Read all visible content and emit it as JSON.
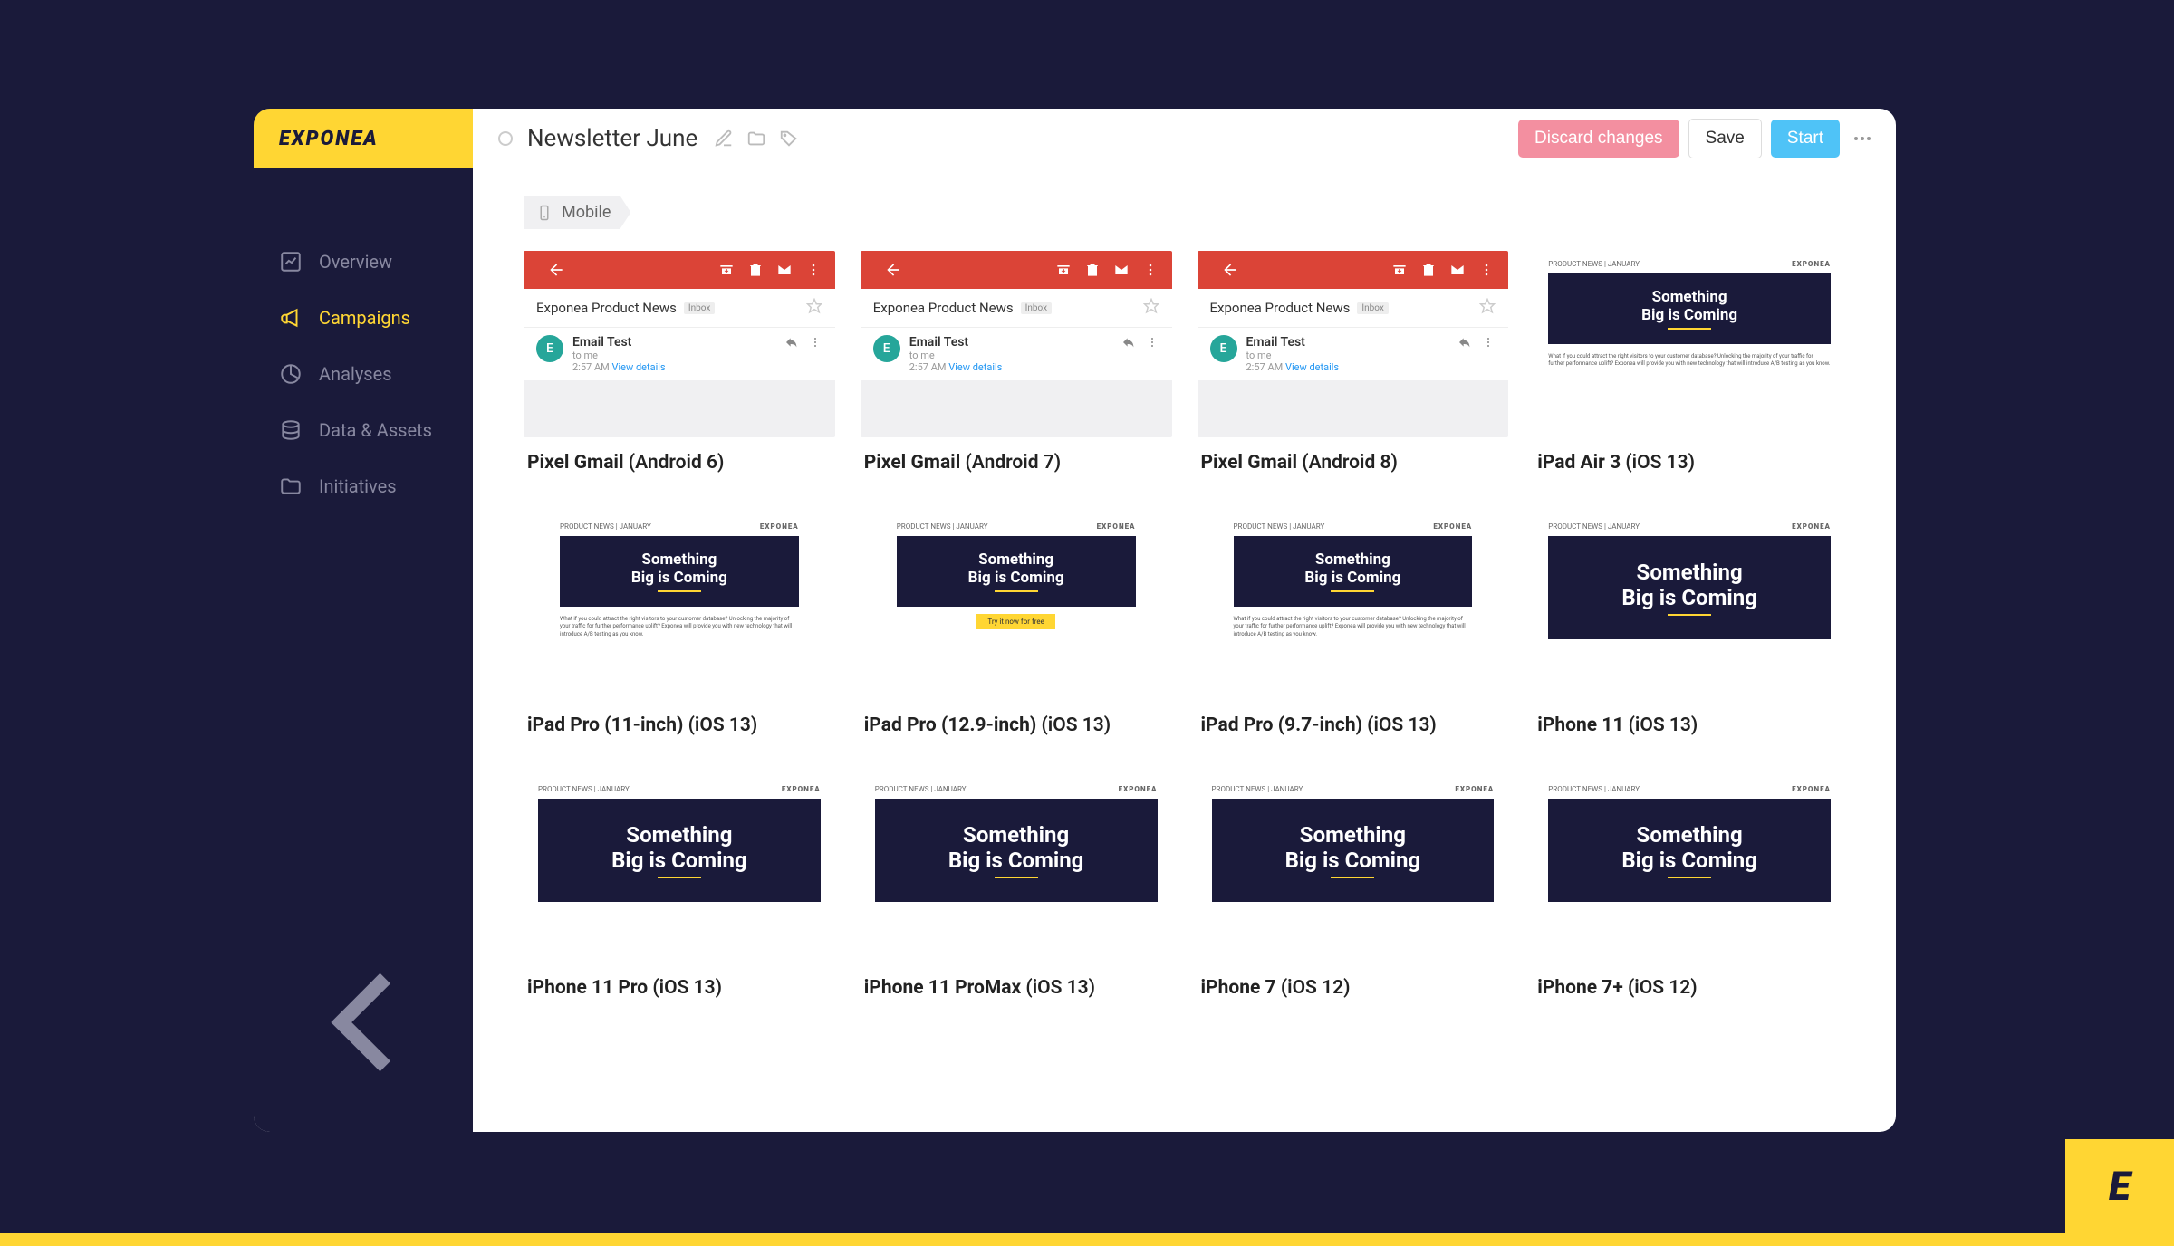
{
  "brand": "EXPONEA",
  "header": {
    "title": "Newsletter June",
    "discard": "Discard changes",
    "save": "Save",
    "start": "Start"
  },
  "sidebar": {
    "items": [
      {
        "label": "Overview"
      },
      {
        "label": "Campaigns"
      },
      {
        "label": "Analyses"
      },
      {
        "label": "Data & Assets"
      },
      {
        "label": "Initiatives"
      }
    ]
  },
  "breadcrumb": {
    "label": "Mobile"
  },
  "gmail": {
    "subject": "Exponea Product News",
    "inbox": "Inbox",
    "sender": "Email Test",
    "to": "to me",
    "time": "2:57 AM",
    "details": "View details",
    "avatar": "E"
  },
  "hero": {
    "tag": "PRODUCT NEWS | JANUARY",
    "brand": "EXPONEA",
    "line1": "Something",
    "line2": "Big is Coming"
  },
  "devices": [
    {
      "type": "gmail",
      "name": "Pixel Gmail",
      "os": "(Android 6)"
    },
    {
      "type": "gmail",
      "name": "Pixel Gmail",
      "os": "(Android 7)"
    },
    {
      "type": "gmail",
      "name": "Pixel Gmail",
      "os": "(Android 8)"
    },
    {
      "type": "ipad",
      "name": "iPad Air 3",
      "os": "(iOS 13)"
    },
    {
      "type": "ipad-small",
      "name": "iPad Pro (11-inch)",
      "os": "(iOS 13)"
    },
    {
      "type": "ipad-small",
      "name": "iPad Pro (12.9-inch)",
      "os": "(iOS 13)",
      "cta": true
    },
    {
      "type": "ipad-small",
      "name": "iPad Pro (9.7-inch)",
      "os": "(iOS 13)"
    },
    {
      "type": "iphone",
      "name": "iPhone 11",
      "os": "(iOS 13)"
    },
    {
      "type": "iphone",
      "name": "iPhone 11 Pro",
      "os": "(iOS 13)"
    },
    {
      "type": "iphone",
      "name": "iPhone 11 ProMax",
      "os": "(iOS 13)"
    },
    {
      "type": "iphone",
      "name": "iPhone 7",
      "os": "(iOS 12)"
    },
    {
      "type": "iphone",
      "name": "iPhone 7+",
      "os": "(iOS 12)"
    }
  ]
}
